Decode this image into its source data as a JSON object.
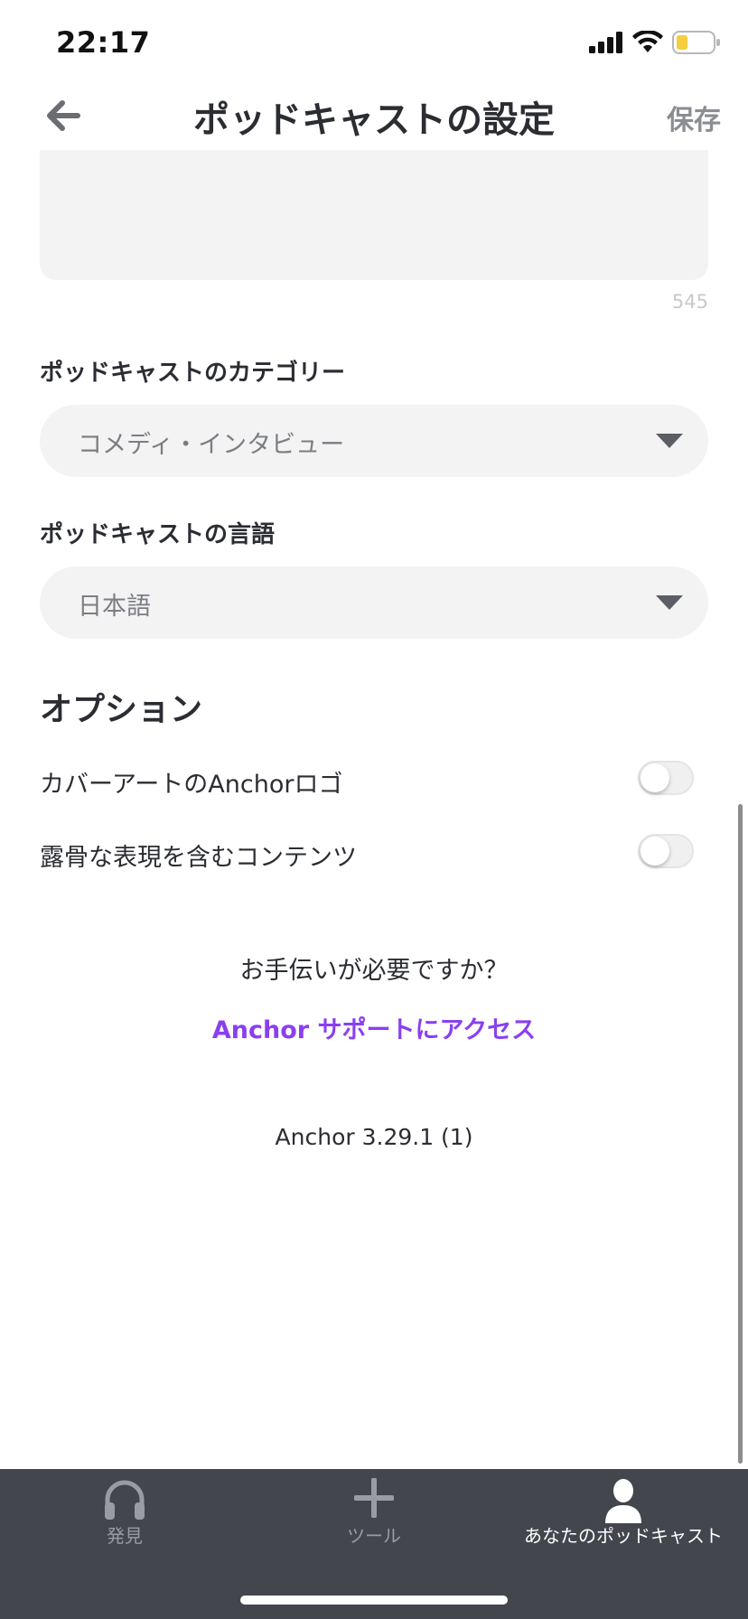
{
  "status_bar": {
    "time": "22:17",
    "battery_color": "#f5cd3d"
  },
  "header": {
    "title": "ポッドキャストの設定",
    "save_label": "保存",
    "back_icon": "arrow-left-icon"
  },
  "description": {
    "char_count": "545"
  },
  "category": {
    "label": "ポッドキャストのカテゴリー",
    "value": "コメディ・インタビュー"
  },
  "language": {
    "label": "ポッドキャストの言語",
    "value": "日本語"
  },
  "options": {
    "heading": "オプション",
    "items": [
      {
        "label": "カバーアートのAnchorロゴ",
        "enabled": false
      },
      {
        "label": "露骨な表現を含むコンテンツ",
        "enabled": false
      }
    ]
  },
  "help": {
    "question": "お手伝いが必要ですか？",
    "link": "Anchor サポートにアクセス",
    "link_color": "#8a3ff0"
  },
  "version": "Anchor 3.29.1 (1)",
  "tab_bar": {
    "background": "#44464d",
    "tabs": [
      {
        "label": "発見",
        "icon": "headphones-icon",
        "active": false
      },
      {
        "label": "ツール",
        "icon": "plus-icon",
        "active": false
      },
      {
        "label": "あなたのポッドキャスト",
        "icon": "person-icon",
        "active": true
      }
    ]
  }
}
